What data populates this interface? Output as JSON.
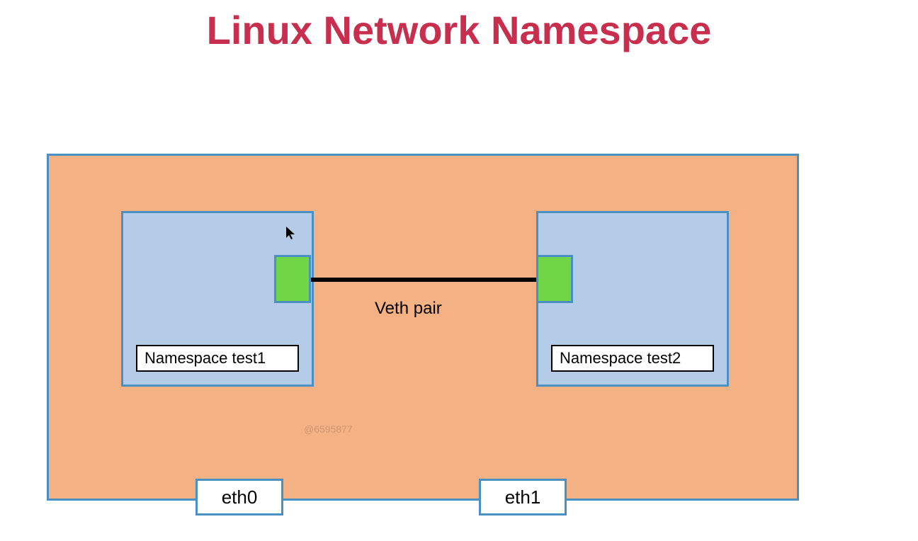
{
  "title": "Linux Network Namespace",
  "namespace1": {
    "label": "Namespace test1"
  },
  "namespace2": {
    "label": "Namespace test2"
  },
  "veth": {
    "label": "Veth pair"
  },
  "interfaces": {
    "eth0": "eth0",
    "eth1": "eth1"
  },
  "watermark": "@6595877",
  "colors": {
    "title": "#c82e4d",
    "host_bg": "#f4b183",
    "border": "#4a90c2",
    "ns_bg": "#b4cce8",
    "veth_endpoint": "#70d646"
  }
}
